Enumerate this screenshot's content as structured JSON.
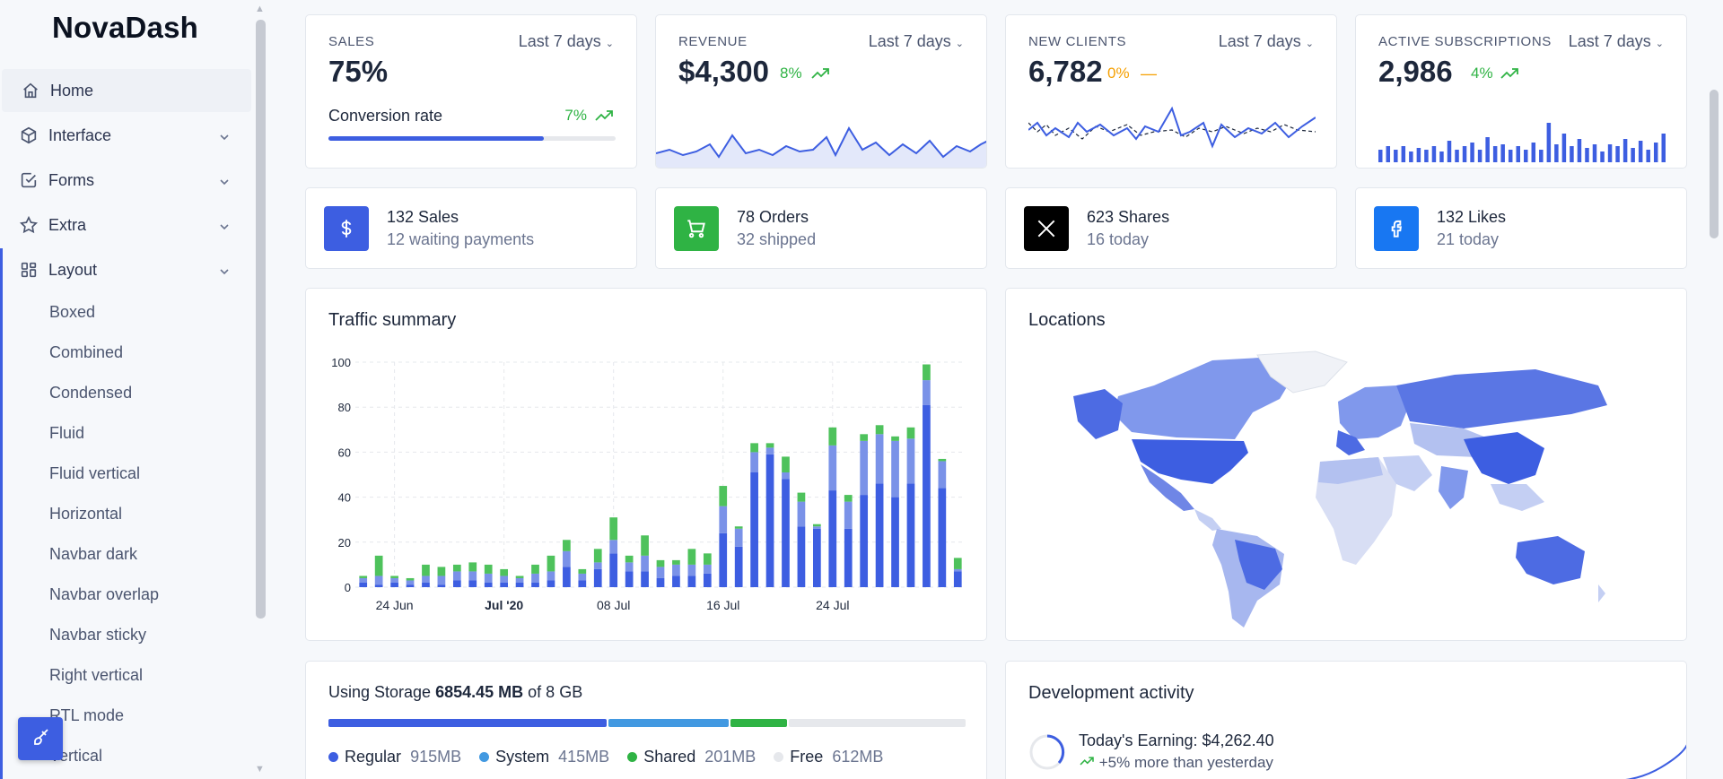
{
  "brand": "NovaDash",
  "sidebar": {
    "items": [
      {
        "label": "Home",
        "icon": "home-icon"
      },
      {
        "label": "Interface",
        "icon": "package-icon"
      },
      {
        "label": "Forms",
        "icon": "checkbox-icon"
      },
      {
        "label": "Extra",
        "icon": "star-icon"
      },
      {
        "label": "Layout",
        "icon": "layout-icon"
      }
    ],
    "layout_sub": [
      "Boxed",
      "Combined",
      "Condensed",
      "Fluid",
      "Fluid vertical",
      "Horizontal",
      "Navbar dark",
      "Navbar overlap",
      "Navbar sticky",
      "Right vertical",
      "RTL mode",
      "Vertical"
    ]
  },
  "kpis": {
    "sales": {
      "label": "SALES",
      "period": "Last 7 days",
      "value": "75%",
      "sub_label": "Conversion rate",
      "sub_delta": "7%",
      "progress": 0.75
    },
    "revenue": {
      "label": "REVENUE",
      "period": "Last 7 days",
      "value": "$4,300",
      "delta": "8%"
    },
    "clients": {
      "label": "NEW CLIENTS",
      "period": "Last 7 days",
      "value": "6,782",
      "delta": "0%"
    },
    "subs": {
      "label": "ACTIVE SUBSCRIPTIONS",
      "period": "Last 7 days",
      "value": "2,986",
      "delta": "4%"
    }
  },
  "mini_cards": [
    {
      "title": "132 Sales",
      "sub": "12 waiting payments",
      "icon": "dollar-icon",
      "color": "#3d5ee1"
    },
    {
      "title": "78 Orders",
      "sub": "32 shipped",
      "icon": "cart-icon",
      "color": "#2fb344"
    },
    {
      "title": "623 Shares",
      "sub": "16 today",
      "icon": "x-logo-icon",
      "color": "#000000"
    },
    {
      "title": "132 Likes",
      "sub": "21 today",
      "icon": "facebook-icon",
      "color": "#0d6efd"
    }
  ],
  "traffic": {
    "title": "Traffic summary"
  },
  "locations": {
    "title": "Locations"
  },
  "storage": {
    "prefix": "Using Storage",
    "used": "6854.45 MB",
    "of": "of 8 GB",
    "segments": [
      {
        "name": "Regular",
        "value": "915MB",
        "color": "#3d5ee1",
        "fraction": 0.44
      },
      {
        "name": "System",
        "value": "415MB",
        "color": "#4299e1",
        "fraction": 0.19
      },
      {
        "name": "Shared",
        "value": "201MB",
        "color": "#2fb344",
        "fraction": 0.09
      },
      {
        "name": "Free",
        "value": "612MB",
        "color": "#e6e8ec",
        "fraction": 0.28
      }
    ]
  },
  "dev": {
    "title": "Development activity",
    "earning": "Today's Earning: $4,262.40",
    "delta": "+5% more than yesterday"
  },
  "chart_data": {
    "type": "bar",
    "stacked": true,
    "ylim": [
      0,
      100
    ],
    "yticks": [
      0,
      20,
      40,
      60,
      80,
      100
    ],
    "xtick_labels": [
      "24 Jun",
      "Jul '20",
      "08 Jul",
      "16 Jul",
      "24 Jul"
    ],
    "colors": [
      "#3d5ee1",
      "#7a92e8",
      "#4ec25c"
    ],
    "series": [
      {
        "values": [
          2,
          1,
          2,
          1,
          2,
          1,
          3,
          3,
          2,
          2,
          2,
          2,
          3,
          9,
          3,
          8,
          15,
          7,
          7,
          4,
          5,
          5,
          6,
          24,
          18,
          51,
          59,
          48,
          27,
          26,
          43,
          26,
          41,
          46,
          40,
          46,
          81,
          44,
          7
        ]
      },
      {
        "values": [
          2,
          4,
          2,
          2,
          3,
          4,
          4,
          4,
          4,
          3,
          2,
          4,
          4,
          7,
          3,
          3,
          6,
          4,
          7,
          5,
          5,
          5,
          4,
          12,
          8,
          9,
          3,
          3,
          11,
          1,
          20,
          12,
          24,
          22,
          25,
          20,
          11,
          12,
          1
        ]
      },
      {
        "values": [
          1,
          9,
          1,
          1,
          5,
          4,
          3,
          4,
          4,
          3,
          1,
          4,
          7,
          5,
          2,
          6,
          10,
          3,
          9,
          3,
          2,
          7,
          5,
          9,
          1,
          4,
          2,
          7,
          4,
          1,
          8,
          3,
          3,
          4,
          2,
          5,
          7,
          1,
          5
        ]
      }
    ]
  }
}
